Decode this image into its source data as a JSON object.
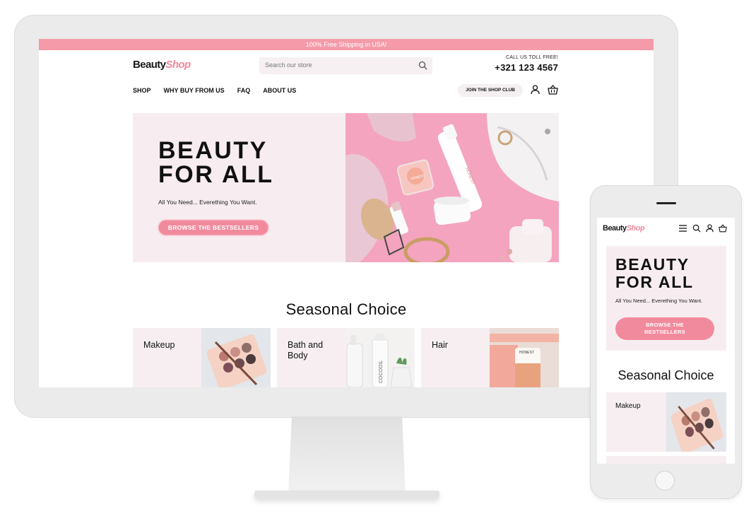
{
  "desktop": {
    "promo_banner": "100% Free Shipping in USA!",
    "logo": {
      "part1": "Beauty",
      "part2": "Shop"
    },
    "search": {
      "placeholder": "Search our store"
    },
    "call": {
      "label": "CALL US TOLL FREE!",
      "number": "+321 123 4567"
    },
    "nav": [
      "SHOP",
      "WHY BUY FROM US",
      "FAQ",
      "ABOUT US"
    ],
    "club_button": "JOIN THE SHOP CLUB",
    "hero": {
      "title_line1": "BEAUTY",
      "title_line2": "FOR ALL",
      "subtitle": "All You Need... Everething You Want.",
      "cta": "BROWSE THE BESTSELLERS"
    },
    "section_title": "Seasonal Choice",
    "categories": [
      "Makeup",
      "Bath and Body",
      "Hair"
    ],
    "product_labels": {
      "honest": "HONEST",
      "cocoil": "COCOOIL"
    }
  },
  "mobile": {
    "logo": {
      "part1": "Beauty",
      "part2": "Shop"
    },
    "hero": {
      "title_line1": "BEAUTY",
      "title_line2": "FOR ALL",
      "subtitle": "All You Need... Everething You Want.",
      "cta_line1": "BROWSE THE",
      "cta_line2": "BESTSELLERS"
    },
    "section_title": "Seasonal Choice",
    "categories": [
      "Makeup"
    ]
  },
  "colors": {
    "accent_pink": "#f28a9d",
    "promo_pink": "#f49aa9",
    "hero_bg": "#f7edf1",
    "device_frame": "#ebebeb"
  },
  "icons": [
    "search-icon",
    "user-icon",
    "basket-icon",
    "hamburger-icon"
  ]
}
